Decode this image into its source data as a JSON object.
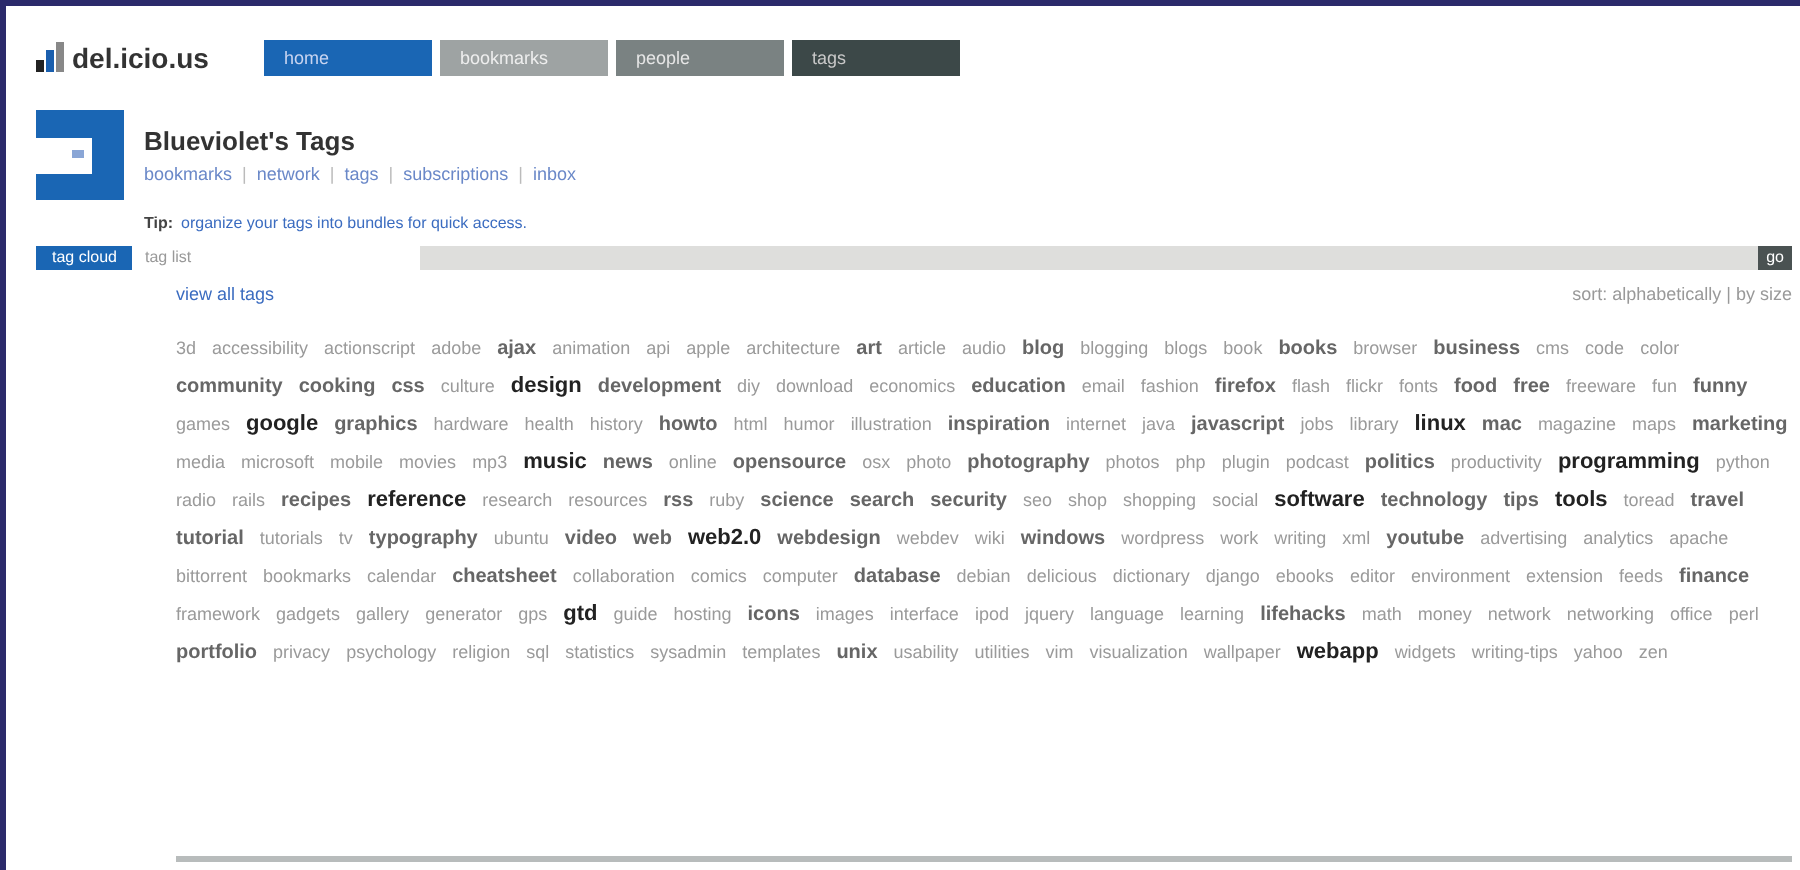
{
  "logo": {
    "text": "del.icio.us"
  },
  "nav_tabs": [
    {
      "label": "home",
      "kind": "blue"
    },
    {
      "label": "bookmarks",
      "kind": "gray"
    },
    {
      "label": "people",
      "kind": "slate"
    },
    {
      "label": "tags",
      "kind": "dark"
    }
  ],
  "profile": {
    "title": "Blueviolet's Tags",
    "links": [
      "bookmarks",
      "network",
      "tags",
      "subscriptions",
      "inbox"
    ],
    "link_separator": "|",
    "tip_label": "Tip:",
    "tip_text": "organize your tags into bundles for quick access."
  },
  "view_tabs": [
    {
      "label": "tag cloud",
      "selected": true
    },
    {
      "label": "tag list",
      "selected": false
    }
  ],
  "filter_button": "go",
  "view_all_link": "view all tags",
  "sort_link": "sort: alphabetically | by size",
  "tags": [
    {
      "label": "3d",
      "kind": "small"
    },
    {
      "label": "accessibility",
      "kind": "small"
    },
    {
      "label": "actionscript",
      "kind": "small"
    },
    {
      "label": "adobe",
      "kind": "small"
    },
    {
      "label": "ajax",
      "kind": "medium"
    },
    {
      "label": "animation",
      "kind": "small"
    },
    {
      "label": "api",
      "kind": "small"
    },
    {
      "label": "apple",
      "kind": "small"
    },
    {
      "label": "architecture",
      "kind": "small"
    },
    {
      "label": "art",
      "kind": "medium"
    },
    {
      "label": "article",
      "kind": "small"
    },
    {
      "label": "audio",
      "kind": "small"
    },
    {
      "label": "blog",
      "kind": "medium"
    },
    {
      "label": "blogging",
      "kind": "small"
    },
    {
      "label": "blogs",
      "kind": "small"
    },
    {
      "label": "book",
      "kind": "small"
    },
    {
      "label": "books",
      "kind": "medium"
    },
    {
      "label": "browser",
      "kind": "small"
    },
    {
      "label": "business",
      "kind": "medium"
    },
    {
      "label": "cms",
      "kind": "small"
    },
    {
      "label": "code",
      "kind": "small"
    },
    {
      "label": "color",
      "kind": "small"
    },
    {
      "label": "community",
      "kind": "medium"
    },
    {
      "label": "cooking",
      "kind": "medium"
    },
    {
      "label": "css",
      "kind": "medium"
    },
    {
      "label": "culture",
      "kind": "small"
    },
    {
      "label": "design",
      "kind": "large"
    },
    {
      "label": "development",
      "kind": "medium"
    },
    {
      "label": "diy",
      "kind": "small"
    },
    {
      "label": "download",
      "kind": "small"
    },
    {
      "label": "economics",
      "kind": "small"
    },
    {
      "label": "education",
      "kind": "medium"
    },
    {
      "label": "email",
      "kind": "small"
    },
    {
      "label": "fashion",
      "kind": "small"
    },
    {
      "label": "firefox",
      "kind": "medium"
    },
    {
      "label": "flash",
      "kind": "small"
    },
    {
      "label": "flickr",
      "kind": "small"
    },
    {
      "label": "fonts",
      "kind": "small"
    },
    {
      "label": "food",
      "kind": "medium"
    },
    {
      "label": "free",
      "kind": "medium"
    },
    {
      "label": "freeware",
      "kind": "small"
    },
    {
      "label": "fun",
      "kind": "small"
    },
    {
      "label": "funny",
      "kind": "medium"
    },
    {
      "label": "games",
      "kind": "small"
    },
    {
      "label": "google",
      "kind": "large"
    },
    {
      "label": "graphics",
      "kind": "medium"
    },
    {
      "label": "hardware",
      "kind": "small"
    },
    {
      "label": "health",
      "kind": "small"
    },
    {
      "label": "history",
      "kind": "small"
    },
    {
      "label": "howto",
      "kind": "medium"
    },
    {
      "label": "html",
      "kind": "small"
    },
    {
      "label": "humor",
      "kind": "small"
    },
    {
      "label": "illustration",
      "kind": "small"
    },
    {
      "label": "inspiration",
      "kind": "medium"
    },
    {
      "label": "internet",
      "kind": "small"
    },
    {
      "label": "java",
      "kind": "small"
    },
    {
      "label": "javascript",
      "kind": "medium"
    },
    {
      "label": "jobs",
      "kind": "small"
    },
    {
      "label": "library",
      "kind": "small"
    },
    {
      "label": "linux",
      "kind": "large"
    },
    {
      "label": "mac",
      "kind": "medium"
    },
    {
      "label": "magazine",
      "kind": "small"
    },
    {
      "label": "maps",
      "kind": "small"
    },
    {
      "label": "marketing",
      "kind": "medium"
    },
    {
      "label": "media",
      "kind": "small"
    },
    {
      "label": "microsoft",
      "kind": "small"
    },
    {
      "label": "mobile",
      "kind": "small"
    },
    {
      "label": "movies",
      "kind": "small"
    },
    {
      "label": "mp3",
      "kind": "small"
    },
    {
      "label": "music",
      "kind": "large"
    },
    {
      "label": "news",
      "kind": "medium"
    },
    {
      "label": "online",
      "kind": "small"
    },
    {
      "label": "opensource",
      "kind": "medium"
    },
    {
      "label": "osx",
      "kind": "small"
    },
    {
      "label": "photo",
      "kind": "small"
    },
    {
      "label": "photography",
      "kind": "medium"
    },
    {
      "label": "photos",
      "kind": "small"
    },
    {
      "label": "php",
      "kind": "small"
    },
    {
      "label": "plugin",
      "kind": "small"
    },
    {
      "label": "podcast",
      "kind": "small"
    },
    {
      "label": "politics",
      "kind": "medium"
    },
    {
      "label": "productivity",
      "kind": "small"
    },
    {
      "label": "programming",
      "kind": "large"
    },
    {
      "label": "python",
      "kind": "small"
    },
    {
      "label": "radio",
      "kind": "small"
    },
    {
      "label": "rails",
      "kind": "small"
    },
    {
      "label": "recipes",
      "kind": "medium"
    },
    {
      "label": "reference",
      "kind": "large"
    },
    {
      "label": "research",
      "kind": "small"
    },
    {
      "label": "resources",
      "kind": "small"
    },
    {
      "label": "rss",
      "kind": "medium"
    },
    {
      "label": "ruby",
      "kind": "small"
    },
    {
      "label": "science",
      "kind": "medium"
    },
    {
      "label": "search",
      "kind": "medium"
    },
    {
      "label": "security",
      "kind": "medium"
    },
    {
      "label": "seo",
      "kind": "small"
    },
    {
      "label": "shop",
      "kind": "small"
    },
    {
      "label": "shopping",
      "kind": "small"
    },
    {
      "label": "social",
      "kind": "small"
    },
    {
      "label": "software",
      "kind": "large"
    },
    {
      "label": "technology",
      "kind": "medium"
    },
    {
      "label": "tips",
      "kind": "medium"
    },
    {
      "label": "tools",
      "kind": "large"
    },
    {
      "label": "toread",
      "kind": "small"
    },
    {
      "label": "travel",
      "kind": "medium"
    },
    {
      "label": "tutorial",
      "kind": "medium"
    },
    {
      "label": "tutorials",
      "kind": "small"
    },
    {
      "label": "tv",
      "kind": "small"
    },
    {
      "label": "typography",
      "kind": "medium"
    },
    {
      "label": "ubuntu",
      "kind": "small"
    },
    {
      "label": "video",
      "kind": "medium"
    },
    {
      "label": "web",
      "kind": "medium"
    },
    {
      "label": "web2.0",
      "kind": "large"
    },
    {
      "label": "webdesign",
      "kind": "medium"
    },
    {
      "label": "webdev",
      "kind": "small"
    },
    {
      "label": "wiki",
      "kind": "small"
    },
    {
      "label": "windows",
      "kind": "medium"
    },
    {
      "label": "wordpress",
      "kind": "small"
    },
    {
      "label": "work",
      "kind": "small"
    },
    {
      "label": "writing",
      "kind": "small"
    },
    {
      "label": "xml",
      "kind": "small"
    },
    {
      "label": "youtube",
      "kind": "medium"
    },
    {
      "label": "advertising",
      "kind": "small"
    },
    {
      "label": "analytics",
      "kind": "small"
    },
    {
      "label": "apache",
      "kind": "small"
    },
    {
      "label": "bittorrent",
      "kind": "small"
    },
    {
      "label": "bookmarks",
      "kind": "small"
    },
    {
      "label": "calendar",
      "kind": "small"
    },
    {
      "label": "cheatsheet",
      "kind": "medium"
    },
    {
      "label": "collaboration",
      "kind": "small"
    },
    {
      "label": "comics",
      "kind": "small"
    },
    {
      "label": "computer",
      "kind": "small"
    },
    {
      "label": "database",
      "kind": "medium"
    },
    {
      "label": "debian",
      "kind": "small"
    },
    {
      "label": "delicious",
      "kind": "small"
    },
    {
      "label": "dictionary",
      "kind": "small"
    },
    {
      "label": "django",
      "kind": "small"
    },
    {
      "label": "ebooks",
      "kind": "small"
    },
    {
      "label": "editor",
      "kind": "small"
    },
    {
      "label": "environment",
      "kind": "small"
    },
    {
      "label": "extension",
      "kind": "small"
    },
    {
      "label": "feeds",
      "kind": "small"
    },
    {
      "label": "finance",
      "kind": "medium"
    },
    {
      "label": "framework",
      "kind": "small"
    },
    {
      "label": "gadgets",
      "kind": "small"
    },
    {
      "label": "gallery",
      "kind": "small"
    },
    {
      "label": "generator",
      "kind": "small"
    },
    {
      "label": "gps",
      "kind": "small"
    },
    {
      "label": "gtd",
      "kind": "large"
    },
    {
      "label": "guide",
      "kind": "small"
    },
    {
      "label": "hosting",
      "kind": "small"
    },
    {
      "label": "icons",
      "kind": "medium"
    },
    {
      "label": "images",
      "kind": "small"
    },
    {
      "label": "interface",
      "kind": "small"
    },
    {
      "label": "ipod",
      "kind": "small"
    },
    {
      "label": "jquery",
      "kind": "small"
    },
    {
      "label": "language",
      "kind": "small"
    },
    {
      "label": "learning",
      "kind": "small"
    },
    {
      "label": "lifehacks",
      "kind": "medium"
    },
    {
      "label": "math",
      "kind": "small"
    },
    {
      "label": "money",
      "kind": "small"
    },
    {
      "label": "network",
      "kind": "small"
    },
    {
      "label": "networking",
      "kind": "small"
    },
    {
      "label": "office",
      "kind": "small"
    },
    {
      "label": "perl",
      "kind": "small"
    },
    {
      "label": "portfolio",
      "kind": "medium"
    },
    {
      "label": "privacy",
      "kind": "small"
    },
    {
      "label": "psychology",
      "kind": "small"
    },
    {
      "label": "religion",
      "kind": "small"
    },
    {
      "label": "sql",
      "kind": "small"
    },
    {
      "label": "statistics",
      "kind": "small"
    },
    {
      "label": "sysadmin",
      "kind": "small"
    },
    {
      "label": "templates",
      "kind": "small"
    },
    {
      "label": "unix",
      "kind": "medium"
    },
    {
      "label": "usability",
      "kind": "small"
    },
    {
      "label": "utilities",
      "kind": "small"
    },
    {
      "label": "vim",
      "kind": "small"
    },
    {
      "label": "visualization",
      "kind": "small"
    },
    {
      "label": "wallpaper",
      "kind": "small"
    },
    {
      "label": "webapp",
      "kind": "large"
    },
    {
      "label": "widgets",
      "kind": "small"
    },
    {
      "label": "writing-tips",
      "kind": "small"
    },
    {
      "label": "yahoo",
      "kind": "small"
    },
    {
      "label": "zen",
      "kind": "small"
    }
  ]
}
